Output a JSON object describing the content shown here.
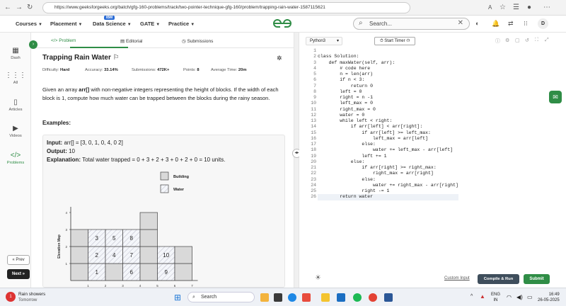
{
  "browser": {
    "url": "https://www.geeksforgeeks.org/batch/gfg-160-problems/track/two-pointer-technique-gfg-160/problem/trapping-rain-water-1587115621"
  },
  "nav": {
    "items": [
      "Courses",
      "Placement",
      "Data Science",
      "GATE",
      "Practice"
    ],
    "badge": "IBM",
    "logo": "GfG",
    "search_placeholder": "Search...",
    "user_initial": "D"
  },
  "sidebar": {
    "items": [
      "Dash",
      "All",
      "Articles",
      "Videos",
      "Problems"
    ],
    "prev": "« Prev",
    "next": "Next »"
  },
  "tabs": [
    "Problem",
    "Editorial",
    "Submissions"
  ],
  "problem": {
    "title": "Trapping Rain Water",
    "difficulty_label": "Difficulty:",
    "difficulty": "Hard",
    "accuracy_label": "Accuracy:",
    "accuracy": "33.14%",
    "submissions_label": "Submissions:",
    "submissions": "472K+",
    "points_label": "Points:",
    "points": "8",
    "avg_time_label": "Average Time:",
    "avg_time": "20m",
    "description_pre": "Given an array ",
    "description_bold": "arr[]",
    "description_post": " with non-negative integers representing the height of blocks. If the width of each block is 1, compute how much water can be trapped between the blocks during the rainy season.",
    "examples_heading": "Examples:",
    "input_label": "Input:",
    "input_value": "arr[] = [3, 0, 1, 0, 4, 0 2]",
    "output_label": "Output:",
    "output_value": "10",
    "explanation_label": "Explanation:",
    "explanation_value": "Total water trapped = 0 + 3 + 2 + 3 + 0 + 2 + 0 = 10 units."
  },
  "chart_data": {
    "type": "bar",
    "ylabel": "Elevation Map",
    "legend": [
      "Building",
      "Water"
    ],
    "x_ticks": [
      "1",
      "2",
      "3",
      "4",
      "5",
      "6",
      "7"
    ],
    "y_ticks": [
      "1",
      "2",
      "3",
      "4"
    ],
    "building": [
      3,
      0,
      1,
      0,
      4,
      0,
      2
    ],
    "water": [
      0,
      3,
      2,
      3,
      0,
      2,
      0
    ],
    "cell_numbers": [
      {
        "col": 1,
        "row": 0,
        "n": "1"
      },
      {
        "col": 1,
        "row": 1,
        "n": "2"
      },
      {
        "col": 1,
        "row": 2,
        "n": "3"
      },
      {
        "col": 2,
        "row": 1,
        "n": "4"
      },
      {
        "col": 2,
        "row": 2,
        "n": "5"
      },
      {
        "col": 3,
        "row": 0,
        "n": "6"
      },
      {
        "col": 3,
        "row": 1,
        "n": "7"
      },
      {
        "col": 3,
        "row": 2,
        "n": "8"
      },
      {
        "col": 5,
        "row": 0,
        "n": "9"
      },
      {
        "col": 5,
        "row": 1,
        "n": "10"
      }
    ]
  },
  "editor": {
    "language": "Python3",
    "timer_label": "Start Timer",
    "code_lines": [
      "",
      "class Solution:",
      "    def maxWater(self, arr):",
      "        # code here",
      "        n = len(arr)",
      "        if n < 3:",
      "            return 0",
      "        left = 0",
      "        right = n -1",
      "        left_max = 0",
      "        right_max = 0",
      "        water = 0",
      "        while left < right:",
      "            if arr[left] < arr[right]:",
      "                if arr[left] >= left_max:",
      "                    left_max = arr[left]",
      "                else:",
      "                    water += left_max - arr[left]",
      "                left += 1",
      "            else:",
      "                if arr[right] >= right_max:",
      "                    right_max = arr[right]",
      "                else:",
      "                    water += right_max - arr[right]",
      "                right -= 1",
      "        return water"
    ],
    "custom_input": "Custom Input",
    "compile_run": "Compile & Run",
    "submit": "Submit"
  },
  "taskbar": {
    "weather_title": "Rain showers",
    "weather_sub": "Tomorrow",
    "weather_badge": "1",
    "search": "Search",
    "lang": "ENG",
    "region": "IN",
    "time": "16:49",
    "date": "26-05-2025"
  }
}
